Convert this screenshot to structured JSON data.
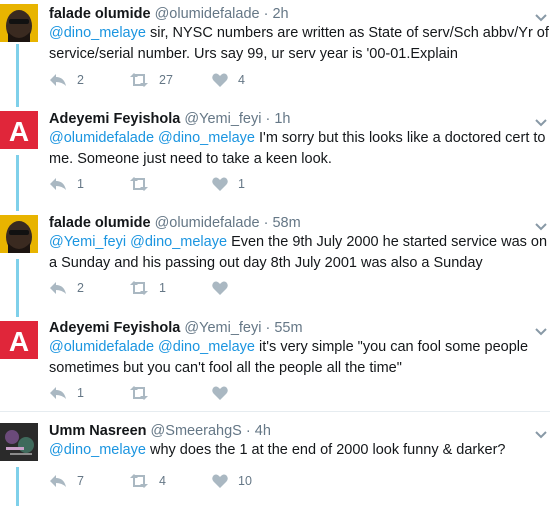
{
  "tweets": [
    {
      "avatar": "falade-avatar",
      "name": "falade olumide",
      "handle": "@olumidefalade",
      "dot": "·",
      "time": "2h",
      "mention1": "@dino_melaye",
      "text_after": " sir, NYSC numbers are written as State of serv/Sch abbv/Yr of service/serial number. Urs say 99, ur serv year is '00-01.Explain",
      "replies": "2",
      "retweets": "27",
      "likes": "4"
    },
    {
      "avatar": "adeyemi-avatar",
      "avatar_letter": "A",
      "name": "Adeyemi Feyishola",
      "handle": "@Yemi_feyi",
      "dot": "·",
      "time": "1h",
      "mention1": "@olumidefalade",
      "mention2": "@dino_melaye",
      "text_after": " I'm sorry but this looks like a doctored cert to me. Someone just need to take a keen look.",
      "replies": "1",
      "retweets": "",
      "likes": "1"
    },
    {
      "avatar": "falade-avatar",
      "name": "falade olumide",
      "handle": "@olumidefalade",
      "dot": "·",
      "time": "58m",
      "mention1": "@Yemi_feyi",
      "mention2": "@dino_melaye",
      "text_after": " Even the 9th July 2000 he started service was on a Sunday and his passing out day 8th July 2001 was also a Sunday",
      "replies": "2",
      "retweets": "1",
      "likes": ""
    },
    {
      "avatar": "adeyemi-avatar",
      "avatar_letter": "A",
      "name": "Adeyemi Feyishola",
      "handle": "@Yemi_feyi",
      "dot": "·",
      "time": "55m",
      "mention1": "@olumidefalade",
      "mention2": "@dino_melaye",
      "text_after": " it's very simple \"you can fool some people sometimes but you can't fool all the people all the time\"",
      "replies": "1",
      "retweets": "",
      "likes": ""
    },
    {
      "avatar": "umm-avatar",
      "name": "Umm Nasreen",
      "handle": "@SmeerahgS",
      "dot": "·",
      "time": "4h",
      "mention1": "@dino_melaye",
      "text_after": " why does the 1 at the end of 2000 look funny & darker?",
      "replies": "7",
      "retweets": "4",
      "likes": "10"
    }
  ],
  "colors": {
    "thread_line": "#7fd0ea",
    "mention": "#1b95e0",
    "muted": "#657786",
    "adeyemi_avatar_bg": "#e0263a",
    "falade_avatar_bg": "#e8b400"
  }
}
